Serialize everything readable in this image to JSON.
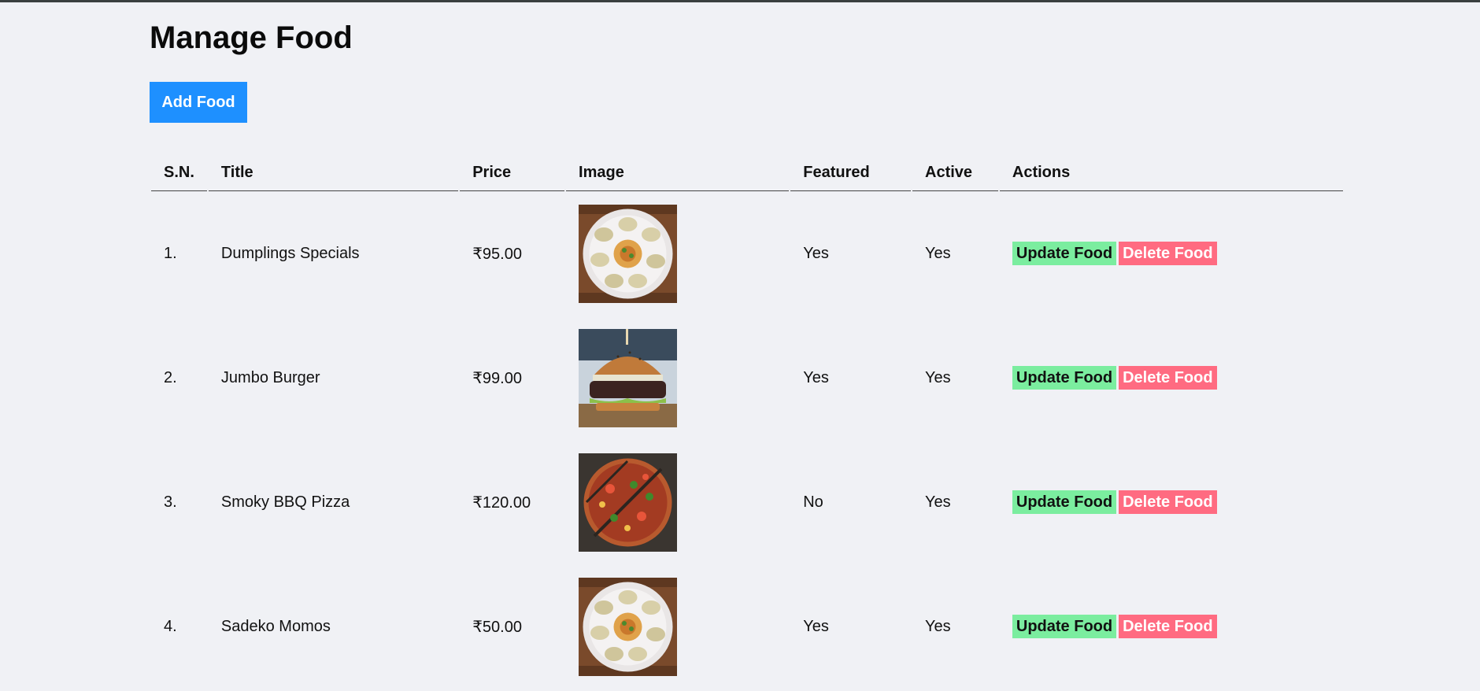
{
  "page": {
    "title": "Manage Food",
    "add_button": "Add Food"
  },
  "colors": {
    "background": "#f0f1f5",
    "add_button": "#1e90ff",
    "update_button": "#7bed9f",
    "delete_button": "#ff6b81"
  },
  "table": {
    "headers": [
      "S.N.",
      "Title",
      "Price",
      "Image",
      "Featured",
      "Active",
      "Actions"
    ],
    "rows": [
      {
        "sn": "1.",
        "title": "Dumplings Specials",
        "price": "₹95.00",
        "image": "dumplings-plate",
        "featured": "Yes",
        "active": "Yes",
        "update": "Update Food",
        "delete": "Delete Food"
      },
      {
        "sn": "2.",
        "title": "Jumbo Burger",
        "price": "₹99.00",
        "image": "burger",
        "featured": "Yes",
        "active": "Yes",
        "update": "Update Food",
        "delete": "Delete Food"
      },
      {
        "sn": "3.",
        "title": "Smoky BBQ Pizza",
        "price": "₹120.00",
        "image": "pizza",
        "featured": "No",
        "active": "Yes",
        "update": "Update Food",
        "delete": "Delete Food"
      },
      {
        "sn": "4.",
        "title": "Sadeko Momos",
        "price": "₹50.00",
        "image": "dumplings-plate",
        "featured": "Yes",
        "active": "Yes",
        "update": "Update Food",
        "delete": "Delete Food"
      }
    ]
  }
}
